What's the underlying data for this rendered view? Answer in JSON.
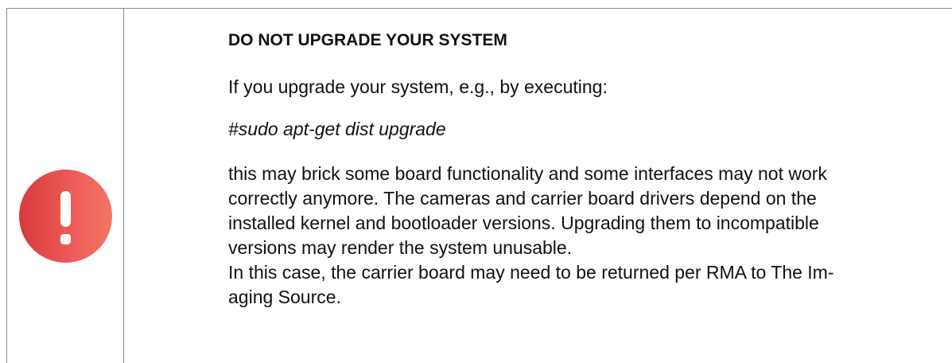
{
  "notice": {
    "icon": "exclamation-circle-icon",
    "icon_colors": [
      "#d83a3a",
      "#f27765"
    ],
    "heading": "DO NOT UPGRADE YOUR SYSTEM",
    "intro": "If you upgrade your system, e.g., by executing:",
    "command": "#sudo apt-get dist upgrade",
    "body_lines": [
      "this may brick some board functionality and some interfaces may not work",
      "correctly anymore. The cameras and carrier board drivers depend on the",
      "installed kernel and bootloader versions. Upgrading them to incompatible",
      "versions may render the system unusable.",
      "In this case, the carrier board may need to be returned per RMA to The Im-",
      "aging Source."
    ]
  }
}
